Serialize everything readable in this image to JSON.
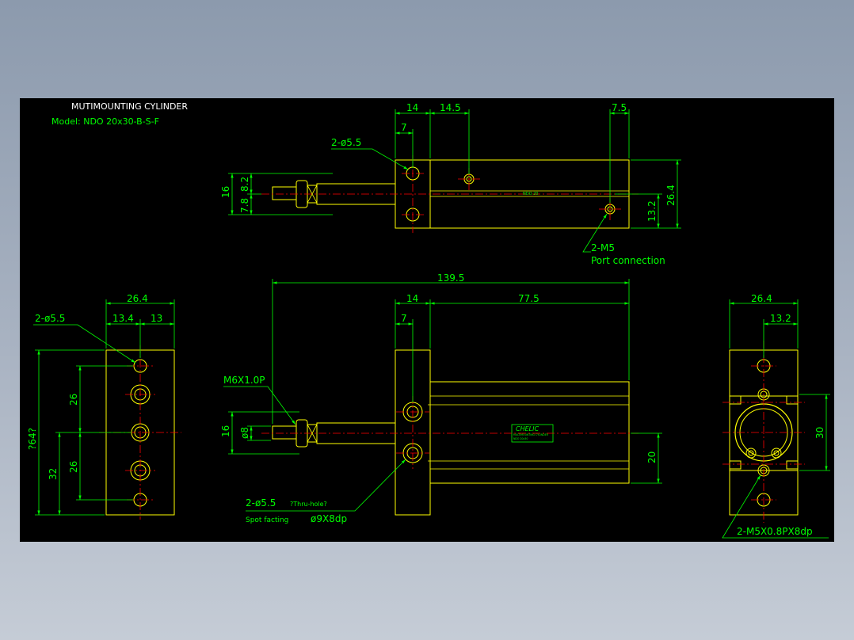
{
  "title": {
    "line1": "MUTIMOUNTING CYLINDER",
    "line2": "Model: NDO 20x30-B-S-F"
  },
  "colors": {
    "background": "#000000",
    "outline": "#ffff00",
    "dimension": "#00ff00",
    "centerline": "#ff0000",
    "text": "#00ff00",
    "title_text": "#ffffff"
  },
  "top_view": {
    "dims": {
      "d14": "14",
      "d14_5": "14.5",
      "d7_5": "7.5",
      "d7": "7",
      "d16": "16",
      "d7_8": "7.8",
      "d8_2": "8.2",
      "d26_4": "26.4",
      "d13_2": "13.2"
    },
    "hole_callout": "2-ø5.5",
    "port_callout": "2-M5",
    "port_note": "Port connection",
    "body_label": "NDO 20"
  },
  "front_view": {
    "dims": {
      "d139_5": "139.5",
      "d14": "14",
      "d77_5": "77.5",
      "d7": "7",
      "d16": "16",
      "d8": "ø8",
      "d20": "20"
    },
    "thread_callout": "M6X1.0P",
    "hole_callout": "2-ø5.5",
    "hole_note": "?Thru-hole?",
    "spot_note": "Spot facting",
    "spot_dim": "ø9X8dp",
    "plate_brand": "CHELIC",
    "plate_line1": "MULTIMOUNTING CYLINDER",
    "plate_line2": "NDO 20x30"
  },
  "left_view": {
    "dims": {
      "d26_4": "26.4",
      "d13_4": "13.4",
      "d13": "13",
      "d64": "?64?",
      "d26a": "26",
      "d26b": "26",
      "d32": "32"
    },
    "hole_callout": "2-ø5.5"
  },
  "right_view": {
    "dims": {
      "d26_4": "26.4",
      "d13_2": "13.2",
      "d30": "30"
    },
    "thread_callout": "2-M5X0.8PX8dp"
  }
}
